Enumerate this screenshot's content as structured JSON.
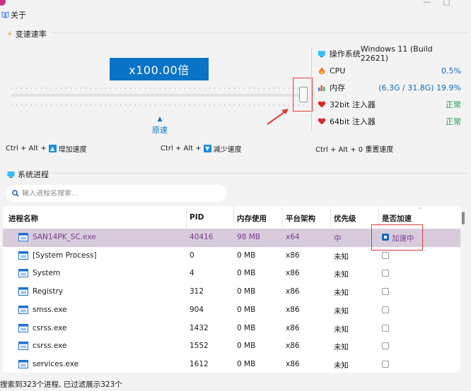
{
  "menu": {
    "about_label": "关于"
  },
  "speed_section": {
    "title": "变速速率",
    "speed_display": "x100.00倍",
    "default_label": "原速",
    "shortcuts": {
      "increase": {
        "prefix": "Ctrl + Alt +",
        "key_icon": "up-arrow-icon",
        "label": "增加速度"
      },
      "decrease": {
        "prefix": "Ctrl + Alt +",
        "key_icon": "down-arrow-icon",
        "label": "减少速度"
      },
      "reset": {
        "text": "Ctrl + Alt + 0 重置速度"
      }
    }
  },
  "system_info": [
    {
      "icon": "monitor-icon",
      "label": "操作系统",
      "value": "Windows 11 (Build 22621)",
      "color": "#1a1a1a"
    },
    {
      "icon": "flame-icon",
      "label": "CPU",
      "value": "0.5%",
      "color": "#1164b8"
    },
    {
      "icon": "bar-chart-icon",
      "label": "内存",
      "value": "(6.3G / 31.8G) 19.9%",
      "color": "#1164b8"
    },
    {
      "icon": "heart-icon",
      "label": "32bit 注入器",
      "value": "正常",
      "color": "#16a34a"
    },
    {
      "icon": "heart-icon",
      "label": "64bit 注入器",
      "value": "正常",
      "color": "#16a34a"
    }
  ],
  "process_section": {
    "title": "系统进程",
    "search_placeholder": "输入进程名搜索...",
    "columns": [
      "进程名称",
      "PID",
      "内存使用",
      "平台架构",
      "优先级",
      "是否加速"
    ],
    "rows": [
      {
        "name": "SAN14PK_SC.exe",
        "pid": "40416",
        "memory": "98 MB",
        "arch": "x64",
        "priority": "中",
        "accelerated": true,
        "accel_label": "加速中"
      },
      {
        "name": "[System Process]",
        "pid": "0",
        "memory": "0 MB",
        "arch": "x86",
        "priority": "未知",
        "accelerated": false,
        "accel_label": ""
      },
      {
        "name": "System",
        "pid": "4",
        "memory": "0 MB",
        "arch": "x86",
        "priority": "未知",
        "accelerated": false,
        "accel_label": ""
      },
      {
        "name": "Registry",
        "pid": "312",
        "memory": "0 MB",
        "arch": "x86",
        "priority": "未知",
        "accelerated": false,
        "accel_label": ""
      },
      {
        "name": "smss.exe",
        "pid": "904",
        "memory": "0 MB",
        "arch": "x86",
        "priority": "未知",
        "accelerated": false,
        "accel_label": ""
      },
      {
        "name": "csrss.exe",
        "pid": "1432",
        "memory": "0 MB",
        "arch": "x86",
        "priority": "未知",
        "accelerated": false,
        "accel_label": ""
      },
      {
        "name": "csrss.exe",
        "pid": "1552",
        "memory": "0 MB",
        "arch": "x86",
        "priority": "未知",
        "accelerated": false,
        "accel_label": ""
      },
      {
        "name": "services.exe",
        "pid": "1612",
        "memory": "0 MB",
        "arch": "x86",
        "priority": "未知",
        "accelerated": false,
        "accel_label": ""
      }
    ]
  },
  "status_bar": {
    "text": "搜索到323个进程, 已过滤展示323个"
  },
  "colors": {
    "accent": "#0a73c6",
    "selected_row": "#d8ccdc",
    "highlight_border": "#e03a3a",
    "ok_green": "#16a34a"
  }
}
